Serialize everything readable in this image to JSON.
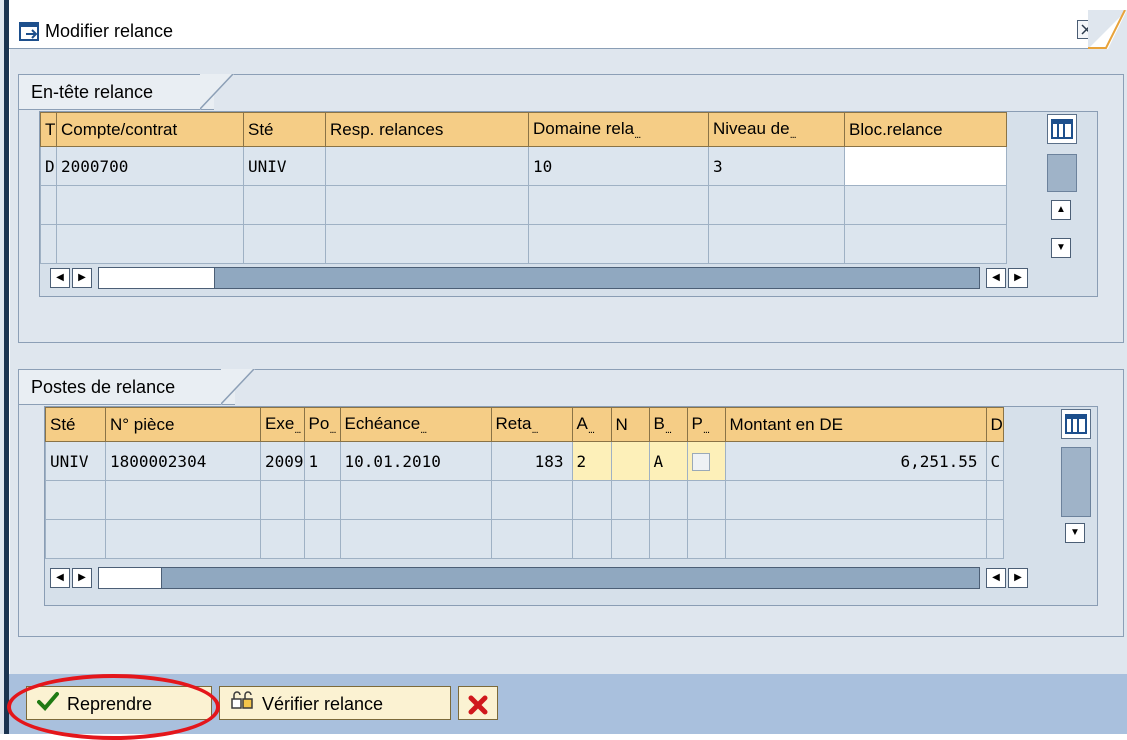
{
  "window": {
    "title": "Modifier relance"
  },
  "header_group": {
    "title": "En-tête relance",
    "columns": [
      "T",
      "Compte/contrat",
      "Sté",
      "Resp. relances",
      "Domaine rela",
      "Niveau de",
      "Bloc.relance"
    ],
    "rows": [
      [
        "D",
        "2000700",
        "UNIV",
        "",
        "10",
        "3",
        ""
      ]
    ]
  },
  "items_group": {
    "title": "Postes de relance",
    "columns": [
      "Sté",
      "N° pièce",
      "Exe",
      "Po",
      "Echéance",
      "Reta",
      "A",
      "N",
      "B",
      "P",
      "Montant en DE",
      "D"
    ],
    "rows": [
      [
        "UNIV",
        "1800002304",
        "2009",
        "1",
        "10.01.2010",
        "183",
        "2",
        "",
        "A",
        "",
        "6,251.55",
        "C"
      ]
    ]
  },
  "footer": {
    "take_over_label": "Reprendre",
    "check_label": "Vérifier relance"
  },
  "colors": {
    "highlight_ring": "#e4161b",
    "header_cell": "#f5cd86",
    "footer_bg": "#a9c0dd"
  }
}
